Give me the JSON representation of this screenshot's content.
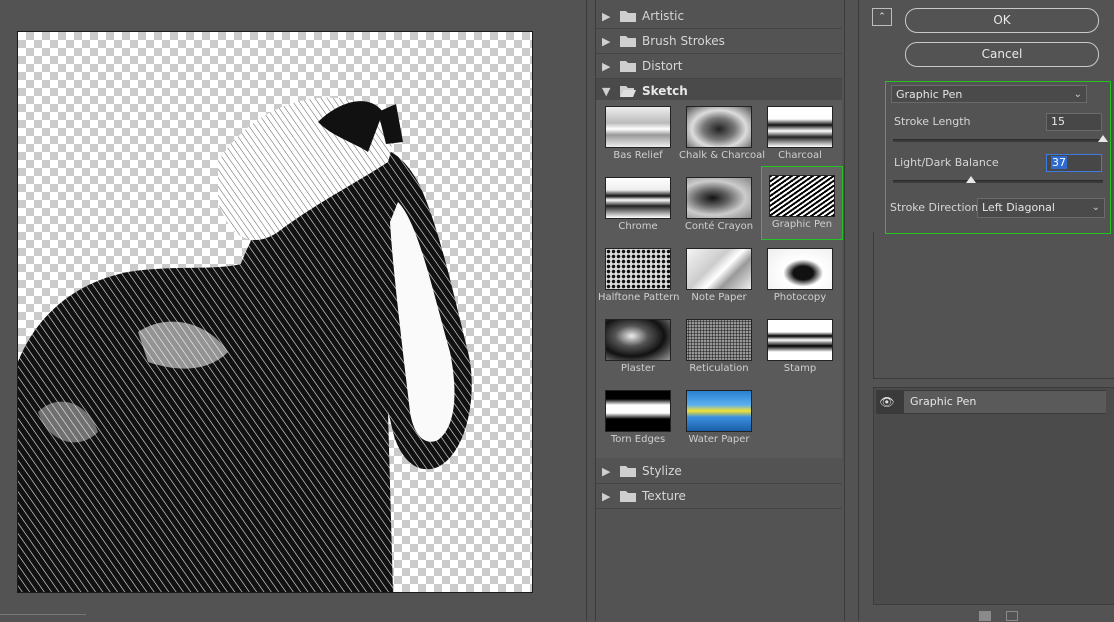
{
  "categories_top": [
    {
      "label": "Artistic",
      "state": "collapsed"
    },
    {
      "label": "Brush Strokes",
      "state": "collapsed"
    },
    {
      "label": "Distort",
      "state": "collapsed"
    },
    {
      "label": "Sketch",
      "state": "expanded"
    }
  ],
  "categories_bottom": [
    {
      "label": "Stylize",
      "state": "collapsed"
    },
    {
      "label": "Texture",
      "state": "collapsed"
    }
  ],
  "sketch_filters": [
    {
      "label": "Bas Relief",
      "icon": "bas-relief-thumbnail"
    },
    {
      "label": "Chalk & Charcoal",
      "icon": "chalk-charcoal-thumbnail"
    },
    {
      "label": "Charcoal",
      "icon": "charcoal-thumbnail"
    },
    {
      "label": "Chrome",
      "icon": "chrome-thumbnail"
    },
    {
      "label": "Conté Crayon",
      "icon": "conte-crayon-thumbnail"
    },
    {
      "label": "Graphic Pen",
      "icon": "graphic-pen-thumbnail",
      "selected": true
    },
    {
      "label": "Halftone Pattern",
      "icon": "halftone-pattern-thumbnail"
    },
    {
      "label": "Note Paper",
      "icon": "note-paper-thumbnail"
    },
    {
      "label": "Photocopy",
      "icon": "photocopy-thumbnail"
    },
    {
      "label": "Plaster",
      "icon": "plaster-thumbnail"
    },
    {
      "label": "Reticulation",
      "icon": "reticulation-thumbnail"
    },
    {
      "label": "Stamp",
      "icon": "stamp-thumbnail"
    },
    {
      "label": "Torn Edges",
      "icon": "torn-edges-thumbnail"
    },
    {
      "label": "Water Paper",
      "icon": "water-paper-thumbnail"
    }
  ],
  "buttons": {
    "ok": "OK",
    "cancel": "Cancel"
  },
  "settings": {
    "filter_name": "Graphic Pen",
    "stroke_length": {
      "label": "Stroke Length",
      "value": "15",
      "level": 1.0
    },
    "light_dark_balance": {
      "label": "Light/Dark Balance",
      "value": "37",
      "level": 0.37
    },
    "stroke_direction": {
      "label": "Stroke Direction:",
      "value": "Left Diagonal"
    }
  },
  "layers": [
    {
      "name": "Graphic Pen",
      "visible": true
    }
  ],
  "colors": {
    "selection_outline": "#22c322",
    "panel_bg": "#535353",
    "focus_blue": "#3d7be0"
  }
}
